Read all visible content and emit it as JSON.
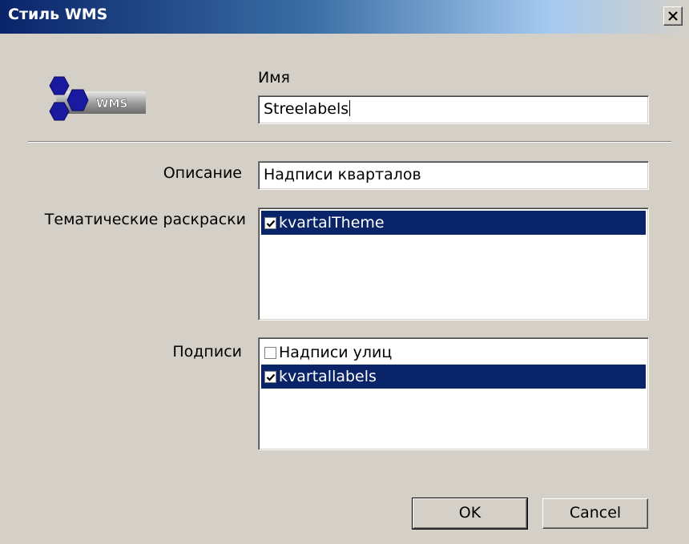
{
  "window": {
    "title": "Стиль WMS",
    "close_label": "×"
  },
  "logo": {
    "text": "WMS"
  },
  "name_field": {
    "label": "Имя",
    "value": "Streelabels"
  },
  "description_field": {
    "label": "Описание",
    "value": "Надписи кварталов"
  },
  "themes": {
    "label": "Тематические раскраски",
    "items": [
      {
        "label": "kvartalTheme",
        "checked": true,
        "selected": true
      }
    ]
  },
  "labels": {
    "label": "Подписи",
    "items": [
      {
        "label": "Надписи улиц",
        "checked": false,
        "selected": false
      },
      {
        "label": "kvartallabels",
        "checked": true,
        "selected": true
      }
    ]
  },
  "buttons": {
    "ok": "OK",
    "cancel": "Cancel"
  },
  "colors": {
    "selection": "#0a246a",
    "dialog_bg": "#d4d0c8"
  }
}
